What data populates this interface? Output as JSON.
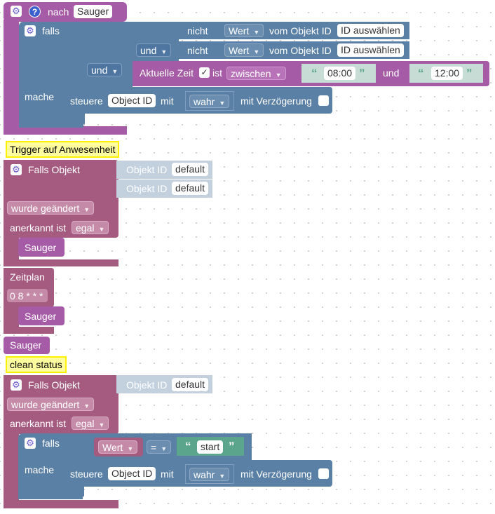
{
  "block1": {
    "header_label": "nach",
    "header_value": "Sauger",
    "falls": "falls",
    "mache": "mache",
    "row1": {
      "nicht": "nicht",
      "wert": "Wert",
      "vom": "vom Objekt ID",
      "id": "ID auswählen"
    },
    "row2": {
      "und": "und",
      "nicht": "nicht",
      "wert": "Wert",
      "vom": "vom Objekt ID",
      "id": "ID auswählen"
    },
    "row3": {
      "und": "und",
      "aktuelle_zeit": "Aktuelle Zeit",
      "check": "✓",
      "ist": "ist",
      "zwischen": "zwischen",
      "from": "08:00",
      "and": "und",
      "to": "12:00"
    },
    "steuere": "steuere",
    "object_id": "Object ID",
    "mit": "mit",
    "wahr": "wahr",
    "verz": "mit Verzögerung"
  },
  "comment1": "Trigger auf Anwesenheit",
  "block2": {
    "falls_objekt": "Falls Objekt",
    "obj1_label": "Objekt ID",
    "obj1_val": "default",
    "obj2_label": "Objekt ID",
    "obj2_val": "default",
    "changed": "wurde geändert",
    "anerkannt": "anerkannt ist",
    "egal": "egal",
    "sauger": "Sauger"
  },
  "block3": {
    "zeitplan": "Zeitplan",
    "cron": "0 8 * * *",
    "sauger": "Sauger"
  },
  "block4": {
    "sauger": "Sauger"
  },
  "comment2": "clean status",
  "block5": {
    "falls_objekt": "Falls Objekt",
    "obj_label": "Objekt ID",
    "obj_val": "default",
    "changed": "wurde geändert",
    "anerkannt": "anerkannt ist",
    "egal": "egal",
    "falls": "falls",
    "mache": "mache",
    "wert": "Wert",
    "eq": "=",
    "start": "start",
    "steuere": "steuere",
    "object_id": "Object ID",
    "mit": "mit",
    "wahr": "wahr",
    "verz": "mit Verzögerung"
  },
  "icons": {
    "gear": "⚙",
    "help": "?"
  }
}
